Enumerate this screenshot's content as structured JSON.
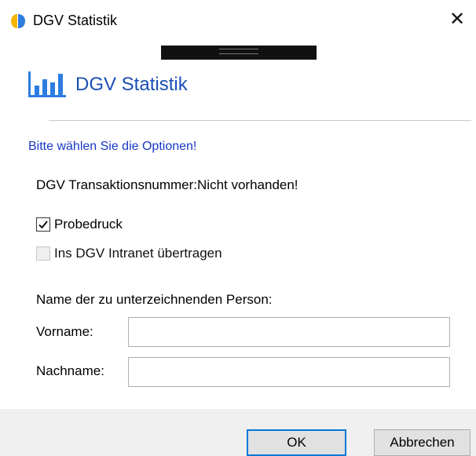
{
  "window": {
    "title": "DGV Statistik",
    "close_symbol": "✕"
  },
  "header": {
    "title": "DGV Statistik",
    "icon": "bar-chart-icon"
  },
  "instruction": "Bitte wählen Sie die Optionen!",
  "transaction": "DGV Transaktionsnummer:Nicht vorhanden!",
  "options": [
    {
      "label": "Probedruck",
      "checked": true,
      "enabled": true
    },
    {
      "label": "Ins DGV Intranet übertragen",
      "checked": false,
      "enabled": false
    }
  ],
  "signatory": {
    "heading": "Name der zu unterzeichnenden Person:",
    "firstname_label": "Vorname:",
    "firstname_value": "",
    "lastname_label": "Nachname:",
    "lastname_value": ""
  },
  "buttons": {
    "ok": "OK",
    "cancel": "Abbrechen"
  },
  "colors": {
    "accent": "#1a4fb5",
    "instruction": "#1838c4",
    "focus_border": "#0078d7",
    "footer_bg": "#f0f0f0",
    "logo_yellow": "#f5b400",
    "logo_blue": "#2d7de0"
  }
}
